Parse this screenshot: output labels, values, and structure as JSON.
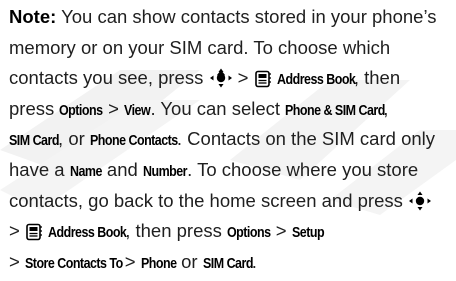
{
  "note": {
    "lead": "Note:",
    "l1_text": " You can show contacts stored in your phone’s",
    "l2_text": "memory or on your SIM card. To choose which",
    "l3_a": "contacts you see, press ",
    "l3_b": " > ",
    "l3_key": "Address Book",
    "l3_c": ", then",
    "l4_a": "press ",
    "l4_key1": "Options",
    "l4_b": " > ",
    "l4_key2": "View",
    "l4_c": ". You can select ",
    "l4_key3": "Phone & SIM Card",
    "l4_d": ",",
    "l5_key1": "SIM Card",
    "l5_a": ", or ",
    "l5_key2": "Phone Contacts",
    "l5_b": ". Contacts on the SIM card only",
    "l6_a": "have a ",
    "l6_key1": "Name",
    "l6_b": " and ",
    "l6_key2": "Number",
    "l6_c": ". To choose where you store",
    "l7_a": "contacts, go back to the home screen and press ",
    "l8_a": "> ",
    "l8_key1": "Address Book",
    "l8_b": ", then press ",
    "l8_key2": "Options",
    "l8_c": " > ",
    "l8_key3": "Setup",
    "l9_a": "> ",
    "l9_key1": "Store Contacts To",
    "l9_b": " > ",
    "l9_key2": "Phone",
    "l9_c": " or ",
    "l9_key3": "SIM Card",
    "l9_d": "."
  },
  "icons": {
    "nav": "nav-key-icon",
    "address_book": "address-book-icon"
  },
  "colors": {
    "text": "#1f1f1f",
    "watermark": "#f1f1f1"
  }
}
